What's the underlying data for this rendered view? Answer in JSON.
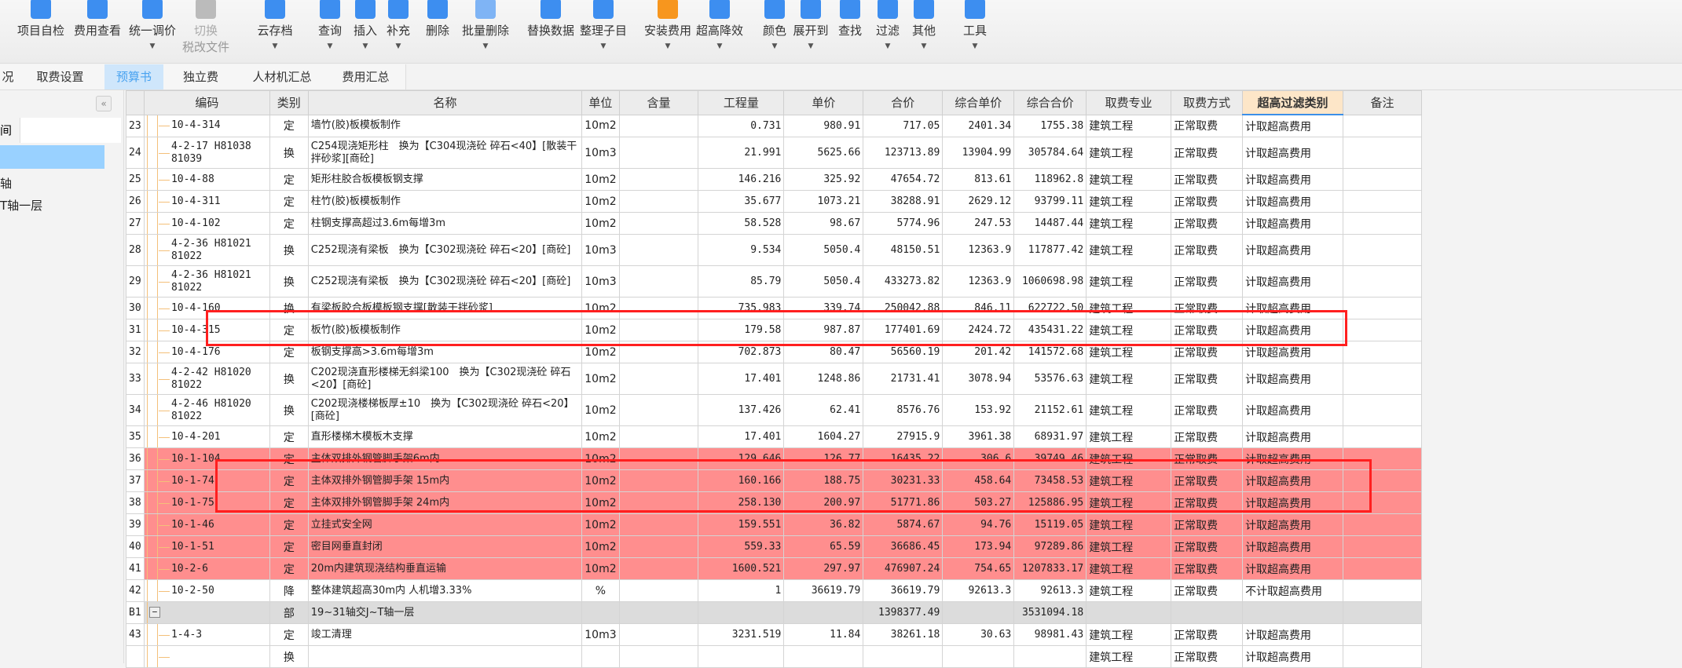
{
  "toolbar": {
    "buttons": [
      {
        "label": "项目自检",
        "icon": "check-doc-icon",
        "caret": false
      },
      {
        "label": "费用查看",
        "icon": "fee-view-icon",
        "caret": false
      },
      {
        "label": "统一调价",
        "icon": "price-adjust-icon",
        "caret": true
      },
      {
        "label": "切换",
        "sub": "税改文件",
        "icon": "tax-switch-icon",
        "caret": false,
        "disabled": true
      },
      {
        "label": "云存档",
        "icon": "cloud-upload-icon",
        "caret": true
      },
      {
        "label": "查询",
        "icon": "query-icon",
        "caret": true
      },
      {
        "label": "插入",
        "icon": "insert-icon",
        "caret": true
      },
      {
        "label": "补充",
        "icon": "supplement-icon",
        "caret": true
      },
      {
        "label": "删除",
        "icon": "delete-icon",
        "caret": false
      },
      {
        "label": "批量删除",
        "icon": "batch-delete-icon",
        "caret": true
      },
      {
        "label": "替换数据",
        "icon": "replace-data-icon",
        "caret": false
      },
      {
        "label": "整理子目",
        "icon": "organize-icon",
        "caret": true
      },
      {
        "label": "安装费用",
        "icon": "install-fee-icon",
        "caret": true
      },
      {
        "label": "超高降效",
        "icon": "overheight-icon",
        "caret": true
      },
      {
        "label": "颜色",
        "icon": "color-icon",
        "caret": true
      },
      {
        "label": "展开到",
        "icon": "expand-to-icon",
        "caret": true
      },
      {
        "label": "查找",
        "icon": "find-icon",
        "caret": false
      },
      {
        "label": "过滤",
        "icon": "filter-icon",
        "caret": true
      },
      {
        "label": "其他",
        "icon": "other-icon",
        "caret": true
      },
      {
        "label": "工具",
        "icon": "tools-icon",
        "caret": true
      }
    ]
  },
  "tabs": [
    {
      "label": "况"
    },
    {
      "label": "取费设置"
    },
    {
      "label": "预算书",
      "active": true
    },
    {
      "label": "独立费"
    },
    {
      "label": "人材机汇总"
    },
    {
      "label": "费用汇总"
    }
  ],
  "left_panel": {
    "collapse_label": "«",
    "search_label": "间",
    "items": [
      "轴",
      "T轴一层"
    ]
  },
  "table": {
    "headers": [
      "",
      "编码",
      "类别",
      "名称",
      "单位",
      "含量",
      "工程量",
      "单价",
      "合价",
      "综合单价",
      "综合合价",
      "取费专业",
      "取费方式",
      "超高过滤类别",
      "备注"
    ],
    "highlight_header": "超高过滤类别",
    "rows": [
      {
        "no": "23",
        "code": "10-4-314",
        "type": "定",
        "name": "墙竹(胶)板模板制作",
        "unit": "10m2",
        "qty_per": "",
        "qty": "0.731",
        "price": "980.91",
        "total": "717.05",
        "comp_price": "2401.34",
        "comp_total": "1755.38",
        "specialty": "建筑工程",
        "method": "正常取费",
        "filter": "计取超高费用",
        "note": ""
      },
      {
        "no": "24",
        "code": "4-2-17 H81038 81039",
        "type": "换",
        "name": "C254现浇矩形柱　换为【C304现浇砼 碎石<40】[散装干拌砂浆][商砼]",
        "unit": "10m3",
        "qty_per": "",
        "qty": "21.991",
        "price": "5625.66",
        "total": "123713.89",
        "comp_price": "13904.99",
        "comp_total": "305784.64",
        "specialty": "建筑工程",
        "method": "正常取费",
        "filter": "计取超高费用",
        "note": "",
        "tall": true
      },
      {
        "no": "25",
        "code": "10-4-88",
        "type": "定",
        "name": "矩形柱胶合板模板钢支撑",
        "unit": "10m2",
        "qty_per": "",
        "qty": "146.216",
        "price": "325.92",
        "total": "47654.72",
        "comp_price": "813.61",
        "comp_total": "118962.8",
        "specialty": "建筑工程",
        "method": "正常取费",
        "filter": "计取超高费用",
        "note": ""
      },
      {
        "no": "26",
        "code": "10-4-311",
        "type": "定",
        "name": "柱竹(胶)板模板制作",
        "unit": "10m2",
        "qty_per": "",
        "qty": "35.677",
        "price": "1073.21",
        "total": "38288.91",
        "comp_price": "2629.12",
        "comp_total": "93799.11",
        "specialty": "建筑工程",
        "method": "正常取费",
        "filter": "计取超高费用",
        "note": ""
      },
      {
        "no": "27",
        "code": "10-4-102",
        "type": "定",
        "name": "柱钢支撑高超过3.6m每增3m",
        "unit": "10m2",
        "qty_per": "",
        "qty": "58.528",
        "price": "98.67",
        "total": "5774.96",
        "comp_price": "247.53",
        "comp_total": "14487.44",
        "specialty": "建筑工程",
        "method": "正常取费",
        "filter": "计取超高费用",
        "note": ""
      },
      {
        "no": "28",
        "code": "4-2-36 H81021 81022",
        "type": "换",
        "name": "C252现浇有梁板　换为【C302现浇砼 碎石<20】[商砼]",
        "unit": "10m3",
        "qty_per": "",
        "qty": "9.534",
        "price": "5050.4",
        "total": "48150.51",
        "comp_price": "12363.9",
        "comp_total": "117877.42",
        "specialty": "建筑工程",
        "method": "正常取费",
        "filter": "计取超高费用",
        "note": "",
        "tall": true
      },
      {
        "no": "29",
        "code": "4-2-36 H81021 81022",
        "type": "换",
        "name": "C252现浇有梁板　换为【C302现浇砼 碎石<20】[商砼]",
        "unit": "10m3",
        "qty_per": "",
        "qty": "85.79",
        "price": "5050.4",
        "total": "433273.82",
        "comp_price": "12363.9",
        "comp_total": "1060698.98",
        "specialty": "建筑工程",
        "method": "正常取费",
        "filter": "计取超高费用",
        "note": "",
        "tall": true
      },
      {
        "no": "30",
        "code": "10-4-160",
        "type": "换",
        "name": "有梁板胶合板模板钢支撑[散装干拌砂浆]",
        "unit": "10m2",
        "qty_per": "",
        "qty": "735.983",
        "price": "339.74",
        "total": "250042.88",
        "comp_price": "846.11",
        "comp_total": "622722.50",
        "specialty": "建筑工程",
        "method": "正常取费",
        "filter": "计取超高费用",
        "note": ""
      },
      {
        "no": "31",
        "code": "10-4-315",
        "type": "定",
        "name": "板竹(胶)板模板制作",
        "unit": "10m2",
        "qty_per": "",
        "qty": "179.58",
        "price": "987.87",
        "total": "177401.69",
        "comp_price": "2424.72",
        "comp_total": "435431.22",
        "specialty": "建筑工程",
        "method": "正常取费",
        "filter": "计取超高费用",
        "note": ""
      },
      {
        "no": "32",
        "code": "10-4-176",
        "type": "定",
        "name": "板钢支撑高>3.6m每增3m",
        "unit": "10m2",
        "qty_per": "",
        "qty": "702.873",
        "price": "80.47",
        "total": "56560.19",
        "comp_price": "201.42",
        "comp_total": "141572.68",
        "specialty": "建筑工程",
        "method": "正常取费",
        "filter": "计取超高费用",
        "note": ""
      },
      {
        "no": "33",
        "code": "4-2-42 H81020 81022",
        "type": "换",
        "name": "C202现浇直形楼梯无斜梁100　换为【C302现浇砼 碎石<20】[商砼]",
        "unit": "10m2",
        "qty_per": "",
        "qty": "17.401",
        "price": "1248.86",
        "total": "21731.41",
        "comp_price": "3078.94",
        "comp_total": "53576.63",
        "specialty": "建筑工程",
        "method": "正常取费",
        "filter": "计取超高费用",
        "note": "",
        "tall": true
      },
      {
        "no": "34",
        "code": "4-2-46 H81020 81022",
        "type": "换",
        "name": "C202现浇楼梯板厚±10　换为【C302现浇砼 碎石<20】[商砼]",
        "unit": "10m2",
        "qty_per": "",
        "qty": "137.426",
        "price": "62.41",
        "total": "8576.76",
        "comp_price": "153.92",
        "comp_total": "21152.61",
        "specialty": "建筑工程",
        "method": "正常取费",
        "filter": "计取超高费用",
        "note": "",
        "tall": true
      },
      {
        "no": "35",
        "code": "10-4-201",
        "type": "定",
        "name": "直形楼梯木模板木支撑",
        "unit": "10m2",
        "qty_per": "",
        "qty": "17.401",
        "price": "1604.27",
        "total": "27915.9",
        "comp_price": "3961.38",
        "comp_total": "68931.97",
        "specialty": "建筑工程",
        "method": "正常取费",
        "filter": "计取超高费用",
        "note": ""
      },
      {
        "no": "36",
        "code": "10-1-104",
        "type": "定",
        "name": "主体双排外钢管脚手架6m内",
        "unit": "10m2",
        "qty_per": "",
        "qty": "129.646",
        "price": "126.77",
        "total": "16435.22",
        "comp_price": "306.6",
        "comp_total": "39749.46",
        "specialty": "建筑工程",
        "method": "正常取费",
        "filter": "计取超高费用",
        "note": "",
        "red": true
      },
      {
        "no": "37",
        "code": "10-1-74",
        "type": "定",
        "name": "主体双排外钢管脚手架 15m内",
        "unit": "10m2",
        "qty_per": "",
        "qty": "160.166",
        "price": "188.75",
        "total": "30231.33",
        "comp_price": "458.64",
        "comp_total": "73458.53",
        "specialty": "建筑工程",
        "method": "正常取费",
        "filter": "计取超高费用",
        "note": "",
        "red": true
      },
      {
        "no": "38",
        "code": "10-1-75",
        "type": "定",
        "name": "主体双排外钢管脚手架 24m内",
        "unit": "10m2",
        "qty_per": "",
        "qty": "258.130",
        "price": "200.97",
        "total": "51771.86",
        "comp_price": "503.27",
        "comp_total": "125886.95",
        "specialty": "建筑工程",
        "method": "正常取费",
        "filter": "计取超高费用",
        "note": "",
        "red": true
      },
      {
        "no": "39",
        "code": "10-1-46",
        "type": "定",
        "name": "立挂式安全网",
        "unit": "10m2",
        "qty_per": "",
        "qty": "159.551",
        "price": "36.82",
        "total": "5874.67",
        "comp_price": "94.76",
        "comp_total": "15119.05",
        "specialty": "建筑工程",
        "method": "正常取费",
        "filter": "计取超高费用",
        "note": "",
        "red": true
      },
      {
        "no": "40",
        "code": "10-1-51",
        "type": "定",
        "name": "密目网垂直封闭",
        "unit": "10m2",
        "qty_per": "",
        "qty": "559.33",
        "price": "65.59",
        "total": "36686.45",
        "comp_price": "173.94",
        "comp_total": "97289.86",
        "specialty": "建筑工程",
        "method": "正常取费",
        "filter": "计取超高费用",
        "note": "",
        "red": true
      },
      {
        "no": "41",
        "code": "10-2-6",
        "type": "定",
        "name": "20m内建筑现浇结构垂直运输",
        "unit": "10m2",
        "qty_per": "",
        "qty": "1600.521",
        "price": "297.97",
        "total": "476907.24",
        "comp_price": "754.65",
        "comp_total": "1207833.17",
        "specialty": "建筑工程",
        "method": "正常取费",
        "filter": "计取超高费用",
        "note": "",
        "red": true
      },
      {
        "no": "42",
        "code": "10-2-50",
        "type": "降",
        "name": "整体建筑超高30m内 人机增3.33%",
        "unit": "%",
        "qty_per": "",
        "qty": "1",
        "price": "36619.79",
        "total": "36619.79",
        "comp_price": "92613.3",
        "comp_total": "92613.3",
        "specialty": "建筑工程",
        "method": "正常取费",
        "filter": "不计取超高费用",
        "note": ""
      },
      {
        "no": "B1",
        "code": "",
        "type": "部",
        "name": "19~31轴交J~T轴一层",
        "unit": "",
        "qty_per": "",
        "qty": "",
        "price": "",
        "total": "1398377.49",
        "comp_price": "",
        "comp_total": "3531094.18",
        "specialty": "",
        "method": "",
        "filter": "",
        "note": "",
        "section": true
      },
      {
        "no": "43",
        "code": "1-4-3",
        "type": "定",
        "name": "竣工清理",
        "unit": "10m3",
        "qty_per": "",
        "qty": "3231.519",
        "price": "11.84",
        "total": "38261.18",
        "comp_price": "30.63",
        "comp_total": "98981.43",
        "specialty": "建筑工程",
        "method": "正常取费",
        "filter": "计取超高费用",
        "note": ""
      },
      {
        "no": "",
        "code": "",
        "type": "换",
        "name": "",
        "unit": "",
        "qty_per": "",
        "qty": "",
        "price": "",
        "total": "",
        "comp_price": "",
        "comp_total": "",
        "specialty": "建筑工程",
        "method": "正常取费",
        "filter": "计取超高费用",
        "note": ""
      }
    ]
  },
  "colors": {
    "highlight_row": "#ff8e8e",
    "annotation_box": "#ff1f1f",
    "active_tab": "#cfe6fb",
    "header_highlight": "#fde6c8"
  }
}
